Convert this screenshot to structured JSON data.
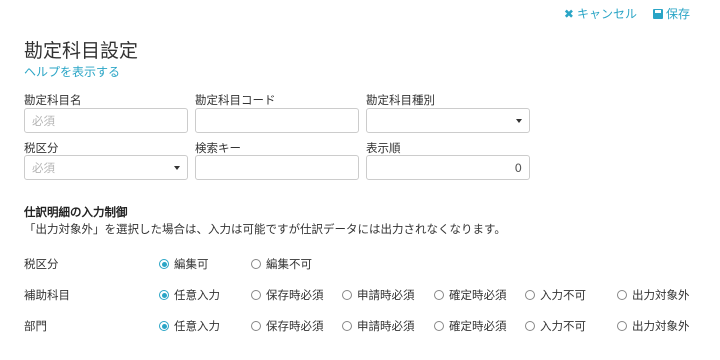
{
  "header": {
    "cancel_icon": "✖",
    "cancel_label": "キャンセル",
    "save_label": "保存"
  },
  "page_title": "勘定科目設定",
  "help_link": "ヘルプを表示する",
  "form": {
    "account_name_label": "勘定科目名",
    "account_name_placeholder": "必須",
    "account_code_label": "勘定科目コード",
    "account_code_value": "",
    "account_type_label": "勘定科目種別",
    "account_type_value": "",
    "tax_category_label": "税区分",
    "tax_category_placeholder": "必須",
    "search_key_label": "検索キー",
    "search_key_value": "",
    "display_order_label": "表示順",
    "display_order_value": "0"
  },
  "input_control": {
    "title": "仕訳明細の入力制御",
    "description": "「出力対象外」を選択した場合は、入力は可能ですが仕訳データには出力されなくなります。",
    "rows": [
      {
        "label": "税区分",
        "options": [
          "編集可",
          "編集不可"
        ],
        "selected": 0
      },
      {
        "label": "補助科目",
        "options": [
          "任意入力",
          "保存時必須",
          "申請時必須",
          "確定時必須",
          "入力不可",
          "出力対象外"
        ],
        "selected": 0
      },
      {
        "label": "部門",
        "options": [
          "任意入力",
          "保存時必須",
          "申請時必須",
          "確定時必須",
          "入力不可",
          "出力対象外"
        ],
        "selected": 0
      }
    ]
  },
  "colors": {
    "accent": "#2aa5c6",
    "border": "#cccccc",
    "text": "#333333"
  }
}
